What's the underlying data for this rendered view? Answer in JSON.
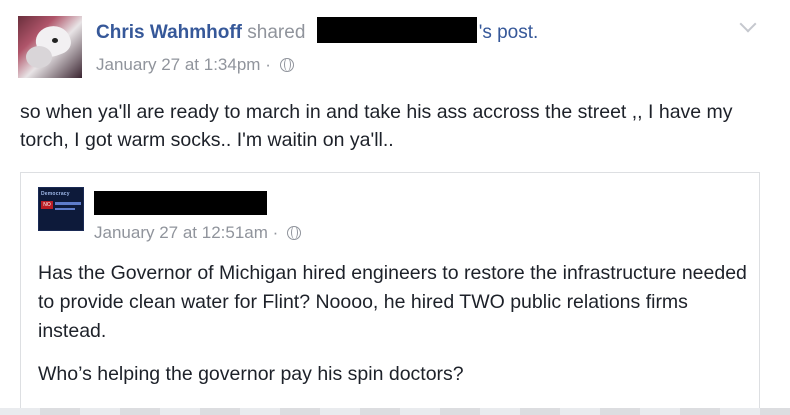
{
  "post": {
    "author": "Chris Wahmhoff",
    "shared_word": "shared",
    "post_suffix": "'s post.",
    "timestamp": "January 27 at 1:34pm",
    "separator": "·",
    "privacy_icon": "globe-icon",
    "options_icon": "chevron-down-icon",
    "message": "so when ya'll are ready to march in and take his ass accross the street ,, I have my torch, I got warm socks.. I'm waitin on ya'll.."
  },
  "shared_post": {
    "page_thumbnail_text": "Democracy",
    "page_thumbnail_badge": "NO",
    "timestamp": "January 27 at 12:51am",
    "separator": "·",
    "privacy_icon": "globe-icon",
    "paragraphs": [
      "Has the Governor of Michigan hired engineers to restore the infrastructure needed to provide clean water for Flint? Noooo, he hired TWO public relations firms instead.",
      "Who’s helping the governor pay his spin doctors?"
    ]
  },
  "colors": {
    "link": "#365899",
    "meta": "#90949c",
    "text": "#1d2129",
    "border": "#dddfe2"
  }
}
